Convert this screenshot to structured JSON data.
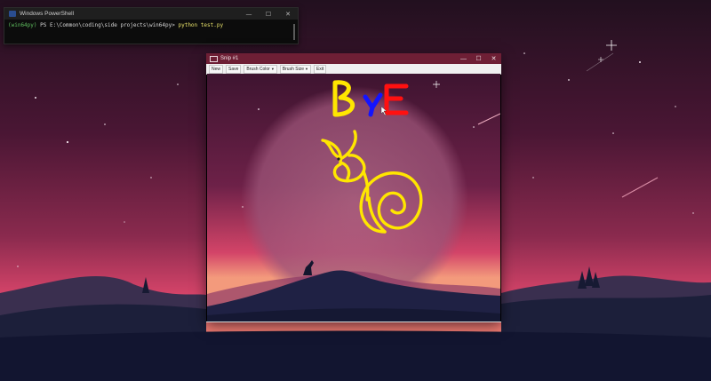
{
  "powershell": {
    "title": "Windows PowerShell",
    "prompt_env": "(win64py)",
    "prompt_path": "PS E:\\Common\\coding\\side projects\\win64py>",
    "command": "python test.py",
    "controls": {
      "minimize": "—",
      "maximize": "☐",
      "close": "✕"
    }
  },
  "snip": {
    "title": "Snip #1",
    "controls": {
      "minimize": "—",
      "maximize": "☐",
      "close": "✕"
    },
    "toolbar": {
      "new_label": "New",
      "save_label": "Save",
      "brush_color_label": "Brush Color",
      "brush_size_label": "Brush Size",
      "exit_label": "Exit"
    },
    "drawing": {
      "letters": [
        "B",
        "Y",
        "E"
      ],
      "letter_colors": [
        "#ffe600",
        "#1414ff",
        "#ff1010"
      ],
      "snail_color": "#ffe600"
    }
  },
  "colors": {
    "sky_top": "#2b1026",
    "sky_mid": "#5a1a3e",
    "sky_horizon": "#e04a6a",
    "moon": "#b8798f",
    "mountain_near": "#151a33",
    "ground": "#0f1226"
  }
}
